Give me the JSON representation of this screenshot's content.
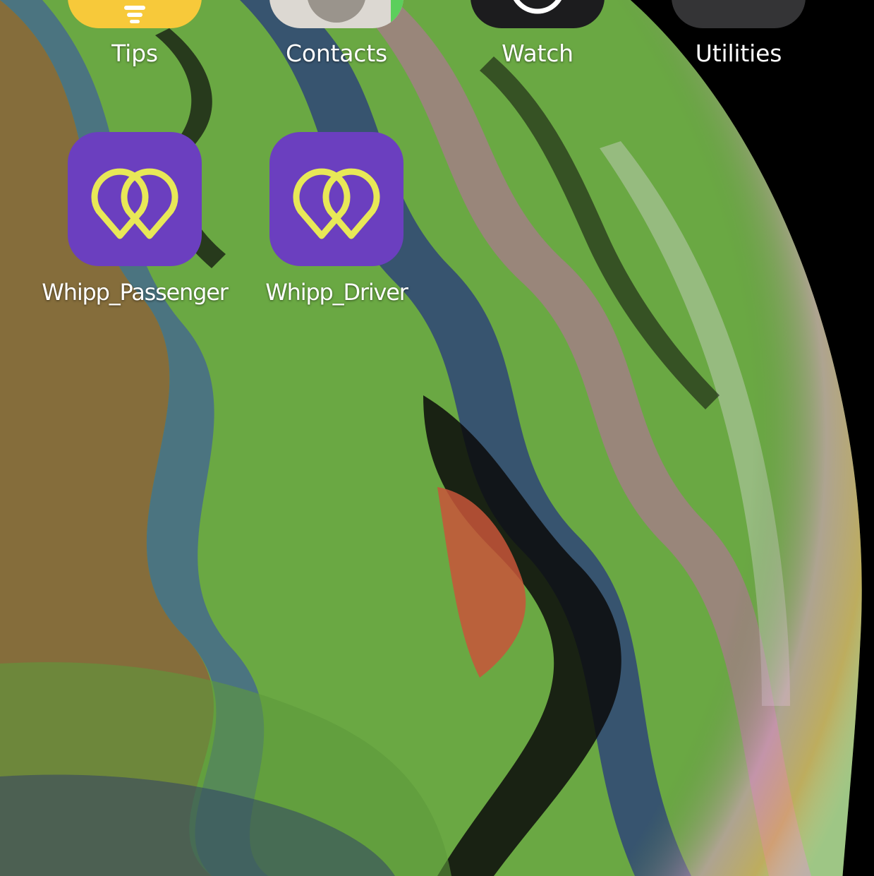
{
  "home_screen": {
    "top_row": [
      {
        "label": "Tips",
        "icon": "lightbulb-icon",
        "color": "#f7c93a"
      },
      {
        "label": "Contacts",
        "icon": "contact-silhouette-icon",
        "color": "#dcd8d2"
      },
      {
        "label": "Watch",
        "icon": "watch-icon",
        "color": "#1c1c1e"
      },
      {
        "label": "Utilities",
        "icon": "folder-icon",
        "color": "#3a3a3c"
      }
    ],
    "second_row": [
      {
        "label": "Whipp_Passenger",
        "icon": "whipp-logo-icon",
        "color": "#6b3fbf",
        "accent": "#e8e857"
      },
      {
        "label": "Whipp_Driver",
        "icon": "whipp-logo-icon",
        "color": "#6b3fbf",
        "accent": "#e8e857"
      }
    ]
  },
  "wallpaper": {
    "name": "iphone-xs-bubble-wallpaper",
    "colors": [
      "#000000",
      "#7ec850",
      "#3e5fa0",
      "#c05a3a",
      "#e05ab8",
      "#f5a060"
    ]
  }
}
